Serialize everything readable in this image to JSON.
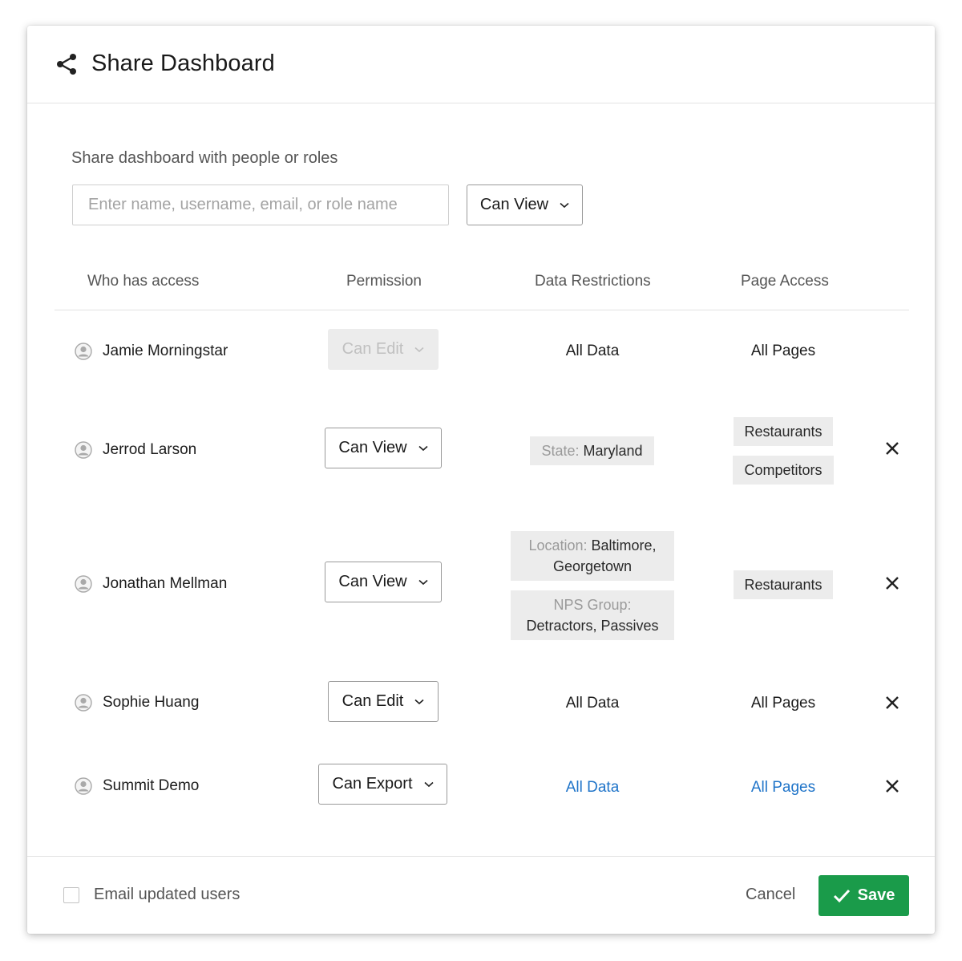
{
  "header": {
    "title": "Share Dashboard",
    "icon": "share-icon"
  },
  "share": {
    "label": "Share dashboard with people or roles",
    "input_placeholder": "Enter name, username, email, or role name",
    "input_value": "",
    "permission_selected": "Can View"
  },
  "columns": {
    "who": "Who has access",
    "permission": "Permission",
    "data": "Data Restrictions",
    "pages": "Page Access"
  },
  "rows": [
    {
      "name": "Jamie Morningstar",
      "permission": "Can Edit",
      "permission_disabled": true,
      "data": "All Data",
      "pages": "All Pages",
      "removable": false
    },
    {
      "name": "Jerrod Larson",
      "permission": "Can View",
      "permission_disabled": false,
      "data_tags": [
        {
          "label": "State:",
          "value": "Maryland"
        }
      ],
      "page_tags": [
        "Restaurants",
        "Competitors"
      ],
      "removable": true
    },
    {
      "name": "Jonathan Mellman",
      "permission": "Can View",
      "permission_disabled": false,
      "data_tags": [
        {
          "label": "Location:",
          "value": "Baltimore,",
          "value2": "Georgetown"
        },
        {
          "label": "NPS Group:",
          "value": "Detractors, Passives"
        }
      ],
      "page_tags": [
        "Restaurants"
      ],
      "removable": true
    },
    {
      "name": "Sophie Huang",
      "permission": "Can Edit",
      "permission_disabled": false,
      "data": "All Data",
      "pages": "All Pages",
      "removable": true
    },
    {
      "name": "Summit Demo",
      "permission": "Can Export",
      "permission_disabled": false,
      "data": "All Data",
      "pages": "All Pages",
      "data_is_link": true,
      "pages_is_link": true,
      "removable": true
    }
  ],
  "footer": {
    "email_label": "Email updated users",
    "email_checked": false,
    "cancel_label": "Cancel",
    "save_label": "Save"
  },
  "colors": {
    "save": "#1a9b4a",
    "link": "#1f74c9",
    "tag_bg": "#ececec"
  }
}
